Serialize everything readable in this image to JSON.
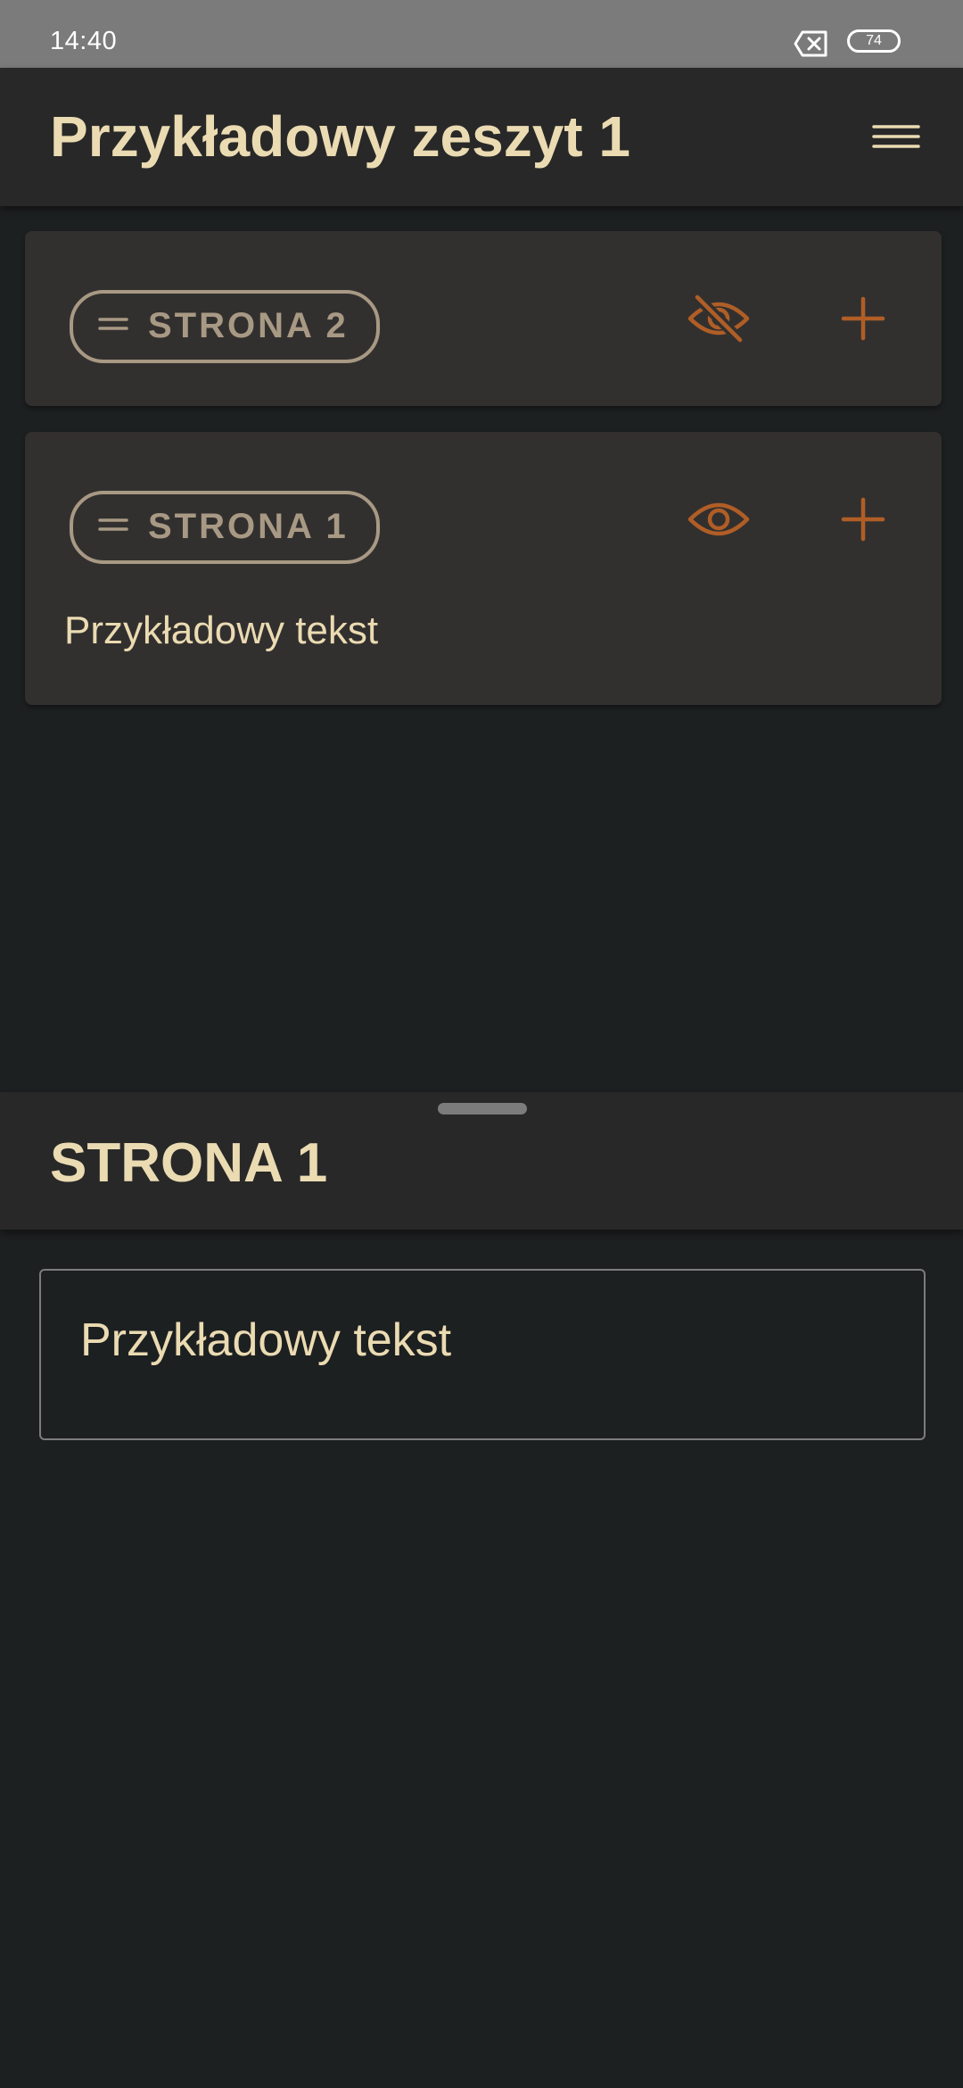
{
  "status_bar": {
    "time": "14:40",
    "battery_level": "74"
  },
  "app_bar": {
    "title": "Przykładowy zeszyt 1",
    "menu_icon": "hamburger-menu-icon"
  },
  "pages": [
    {
      "label": "STRONA 2",
      "visibility_icon": "eye-off-icon",
      "visible": false,
      "text": ""
    },
    {
      "label": "STRONA 1",
      "visibility_icon": "eye-icon",
      "visible": true,
      "text": "Przykładowy tekst"
    }
  ],
  "bottom_sheet": {
    "title": "STRONA 1",
    "text_value": "Przykładowy tekst"
  },
  "colors": {
    "background": "#1d2021",
    "surface": "#282828",
    "card": "#32302f",
    "text_primary": "#ebdbb2",
    "chip_outline": "#a89984",
    "accent": "#b05e26",
    "status_bar": "#7b7b7b"
  }
}
